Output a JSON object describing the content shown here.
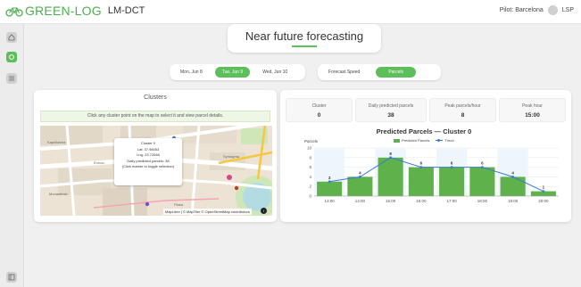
{
  "app": {
    "logo_text": "GREEN-LOG",
    "logo_sub": "LM-DCT",
    "pilot": "Pilot: Barcelona",
    "user": "LSP"
  },
  "icons": {
    "logo": "bicycle-icon",
    "home": "home-icon",
    "cluster": "cluster-icon",
    "list": "list-icon",
    "collapse": "collapse-sidebar-icon",
    "avatar": "user-avatar-icon"
  },
  "colors": {
    "accent": "#5cbf5a",
    "bar": "#5fb14b",
    "trend": "#3a7bd5"
  },
  "page": {
    "title": "Near future forecasting"
  },
  "days": [
    "Mon, Jun 8",
    "Tue, Jun 9",
    "Wed, Jun 10"
  ],
  "active_day": "Tue, Jun 9",
  "metrics": [
    "Forecast Speed",
    "Parcels"
  ],
  "active_metric": "Parcels",
  "clusters": {
    "title": "Clusters",
    "hint": "Click any cluster point on the map to select it and view parcel details.",
    "tooltip": {
      "name": "Cluster 0",
      "lat": "Lat: 37.98453",
      "lng": "Lng: 23.72648",
      "daily": "Daily predicted parcels: 38",
      "toggle": "(Click marker to toggle selection)"
    },
    "attribution": "MapLibre | © MapTiler © OpenStreetMap contributors",
    "info": "i",
    "map_labels": [
      "Odeon of Herodes",
      "Ermou",
      "Kapnikarea",
      "Plaka",
      "Syntagma",
      "Monastiraki"
    ]
  },
  "kpis": [
    {
      "label": "Cluster",
      "value": "0"
    },
    {
      "label": "Daily predicted parcels",
      "value": "38"
    },
    {
      "label": "Peak parcels/hour",
      "value": "8"
    },
    {
      "label": "Peak hour",
      "value": "15:00"
    }
  ],
  "chart_data": {
    "type": "bar",
    "title": "Predicted Parcels — Cluster 0",
    "ylabel": "Parcels",
    "categories": [
      "13:00",
      "14:00",
      "15:00",
      "16:00",
      "17:00",
      "18:00",
      "19:00",
      "20:00"
    ],
    "series": [
      {
        "name": "Predicted Parcels",
        "type": "bar",
        "values": [
          3,
          4,
          8,
          6,
          6,
          6,
          4,
          1
        ]
      },
      {
        "name": "Trend",
        "type": "line",
        "values": [
          3,
          4,
          8,
          6,
          6,
          6,
          4,
          1
        ]
      }
    ],
    "yticks": [
      0,
      2,
      4,
      6,
      8,
      10
    ],
    "ylim": [
      0,
      10
    ],
    "legend": "top"
  }
}
